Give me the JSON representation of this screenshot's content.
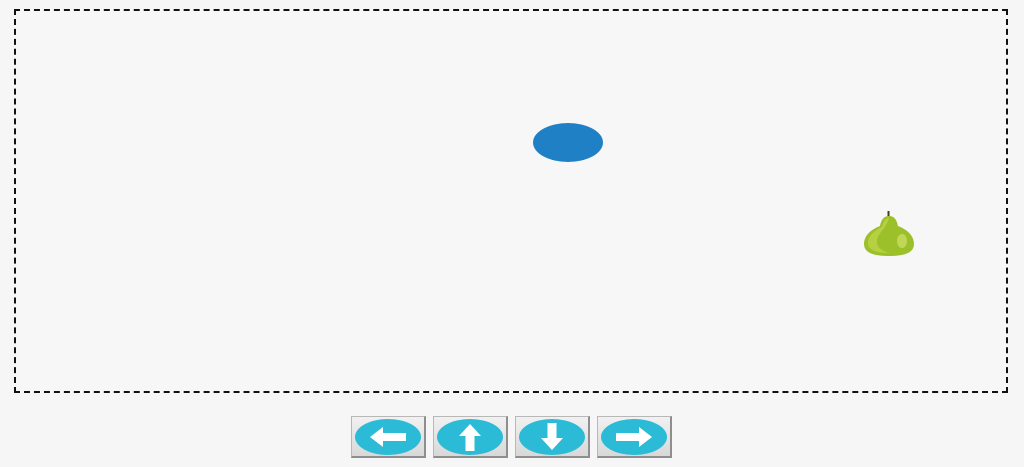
{
  "game": {
    "player": {
      "shape": "ellipse",
      "color": "#1f80c6"
    },
    "fruit": {
      "icon": "pear-icon",
      "color": "#a6c62c"
    }
  },
  "controls": [
    {
      "name": "left",
      "icon": "arrow-left-icon"
    },
    {
      "name": "up",
      "icon": "arrow-up-icon"
    },
    {
      "name": "down",
      "icon": "arrow-down-icon"
    },
    {
      "name": "right",
      "icon": "arrow-right-icon"
    }
  ],
  "colors": {
    "button_fill": "#2cbbd6",
    "arrow": "#ffffff",
    "border": "#111111",
    "background": "#f6f6f6"
  }
}
